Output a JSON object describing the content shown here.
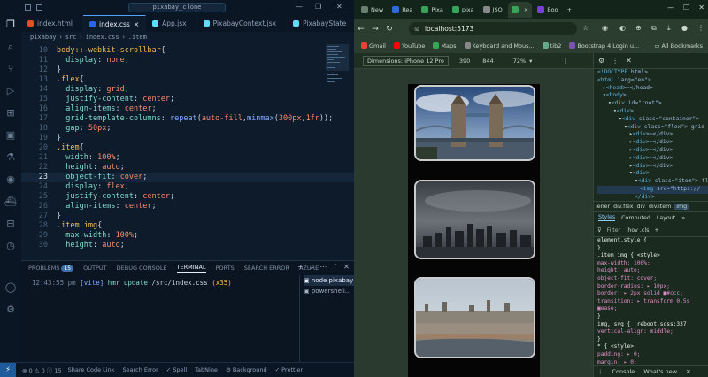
{
  "vscode": {
    "search": "pixabay_clone",
    "tabs": [
      {
        "label": "index.html",
        "color": "#e44d26"
      },
      {
        "label": "index.css",
        "color": "#2965f1",
        "active": true
      },
      {
        "label": "App.jsx",
        "color": "#61dafb"
      },
      {
        "label": "PixabayContext.jsx",
        "color": "#61dafb"
      },
      {
        "label": "PixabayState",
        "color": "#61dafb"
      }
    ],
    "breadcrumb": [
      "pixabay",
      "›",
      "src",
      "›",
      "index.css",
      "›",
      ".item"
    ],
    "lines": [
      {
        "n": "10",
        "code": [
          [
            "sel",
            "body::-webkit-scrollbar"
          ],
          [
            "pun",
            "{"
          ]
        ]
      },
      {
        "n": "11",
        "code": [
          [
            "pun",
            "  "
          ],
          [
            "prop",
            "display"
          ],
          [
            "pun",
            ": "
          ],
          [
            "val",
            "none"
          ],
          [
            "pun",
            ";"
          ]
        ]
      },
      {
        "n": "12",
        "code": [
          [
            "pun",
            "}"
          ]
        ]
      },
      {
        "n": "13",
        "code": [
          [
            "sel",
            ".flex"
          ],
          [
            "pun",
            "{"
          ]
        ]
      },
      {
        "n": "14",
        "code": [
          [
            "pun",
            "  "
          ],
          [
            "prop",
            "display"
          ],
          [
            "pun",
            ": "
          ],
          [
            "val",
            "grid"
          ],
          [
            "pun",
            ";"
          ]
        ]
      },
      {
        "n": "15",
        "code": [
          [
            "pun",
            "  "
          ],
          [
            "prop",
            "justify-content"
          ],
          [
            "pun",
            ": "
          ],
          [
            "val",
            "center"
          ],
          [
            "pun",
            ";"
          ]
        ]
      },
      {
        "n": "16",
        "code": [
          [
            "pun",
            "  "
          ],
          [
            "prop",
            "align-items"
          ],
          [
            "pun",
            ": "
          ],
          [
            "val",
            "center"
          ],
          [
            "pun",
            ";"
          ]
        ]
      },
      {
        "n": "17",
        "code": [
          [
            "pun",
            "  "
          ],
          [
            "prop",
            "grid-template-columns"
          ],
          [
            "pun",
            ": "
          ],
          [
            "fn",
            "repeat"
          ],
          [
            "pun",
            "("
          ],
          [
            "val",
            "auto-fill"
          ],
          [
            "pun",
            ","
          ],
          [
            "fn",
            "minmax"
          ],
          [
            "pun",
            "("
          ],
          [
            "num",
            "300px"
          ],
          [
            "pun",
            ","
          ],
          [
            "num",
            "1fr"
          ],
          [
            "pun",
            "));"
          ]
        ]
      },
      {
        "n": "18",
        "code": [
          [
            "pun",
            "  "
          ],
          [
            "prop",
            "gap"
          ],
          [
            "pun",
            ": "
          ],
          [
            "num",
            "50px"
          ],
          [
            "pun",
            ";"
          ]
        ]
      },
      {
        "n": "19",
        "code": [
          [
            "pun",
            "}"
          ]
        ]
      },
      {
        "n": "20",
        "code": [
          [
            "sel",
            ".item"
          ],
          [
            "pun",
            "{"
          ]
        ]
      },
      {
        "n": "21",
        "code": [
          [
            "pun",
            "  "
          ],
          [
            "prop",
            "width"
          ],
          [
            "pun",
            ": "
          ],
          [
            "num",
            "100%"
          ],
          [
            "pun",
            ";"
          ]
        ]
      },
      {
        "n": "22",
        "code": [
          [
            "pun",
            "  "
          ],
          [
            "prop",
            "height"
          ],
          [
            "pun",
            ": "
          ],
          [
            "val",
            "auto"
          ],
          [
            "pun",
            ";"
          ]
        ]
      },
      {
        "n": "23",
        "code": [
          [
            "pun",
            "  "
          ],
          [
            "prop",
            "object-fit"
          ],
          [
            "pun",
            ": "
          ],
          [
            "val",
            "cover"
          ],
          [
            "pun",
            ";"
          ]
        ]
      },
      {
        "n": "24",
        "code": [
          [
            "pun",
            "  "
          ],
          [
            "prop",
            "display"
          ],
          [
            "pun",
            ": "
          ],
          [
            "val",
            "flex"
          ],
          [
            "pun",
            ";"
          ]
        ]
      },
      {
        "n": "25",
        "code": [
          [
            "pun",
            "  "
          ],
          [
            "prop",
            "justify-content"
          ],
          [
            "pun",
            ": "
          ],
          [
            "val",
            "center"
          ],
          [
            "pun",
            ";"
          ]
        ]
      },
      {
        "n": "26",
        "code": [
          [
            "pun",
            "  "
          ],
          [
            "prop",
            "align-items"
          ],
          [
            "pun",
            ": "
          ],
          [
            "val",
            "center"
          ],
          [
            "pun",
            ";"
          ]
        ]
      },
      {
        "n": "27",
        "code": [
          [
            "pun",
            "}"
          ]
        ]
      },
      {
        "n": "28",
        "code": [
          [
            "sel",
            ".item img"
          ],
          [
            "pun",
            "{"
          ]
        ]
      },
      {
        "n": "29",
        "code": [
          [
            "pun",
            "  "
          ],
          [
            "prop",
            "max-width"
          ],
          [
            "pun",
            ": "
          ],
          [
            "num",
            "100%"
          ],
          [
            "pun",
            ";"
          ]
        ]
      },
      {
        "n": "30",
        "code": [
          [
            "pun",
            "  "
          ],
          [
            "prop",
            "height"
          ],
          [
            "pun",
            ": "
          ],
          [
            "val",
            "auto"
          ],
          [
            "pun",
            ";"
          ]
        ]
      }
    ],
    "current_line": "23",
    "panel": {
      "tabs": [
        "PROBLEMS",
        "OUTPUT",
        "DEBUG CONSOLE",
        "TERMINAL",
        "PORTS",
        "SEARCH ERROR",
        "AZURE"
      ],
      "active_tab": "TERMINAL",
      "problems_count": "15",
      "terminal_time": "12:43:55 pm",
      "terminal_tag": "[vite]",
      "terminal_msg": "hmr update",
      "terminal_path": "/src/index.css",
      "terminal_count": "(x35)",
      "terminals": [
        "node pixabay",
        "powershell..."
      ]
    },
    "status": {
      "remote": "⚡",
      "errors": "⊗ 0 ⚠ 0 ⓘ 15",
      "items": [
        "Share Code Link",
        "Search Error",
        "✓ Spell",
        "TabNine",
        "⚙ Background",
        "✓ Prettier"
      ]
    }
  },
  "browser": {
    "tabs": [
      {
        "label": "New",
        "color": "#6a7f70"
      },
      {
        "label": "Rea",
        "color": "#2d6cdf"
      },
      {
        "label": "Pixa",
        "color": "#3aa35a"
      },
      {
        "label": "pixa",
        "color": "#3aa35a"
      },
      {
        "label": "JSO",
        "color": "#888"
      },
      {
        "label": "",
        "color": "#3aa35a",
        "active": true
      },
      {
        "label": "Boo",
        "color": "#7a3fd6"
      }
    ],
    "url": "localhost:5173",
    "bookmarks": [
      "Gmail",
      "YouTube",
      "Maps",
      "Keyboard and Mous...",
      "tib2",
      "Bootstrap 4 Login u..."
    ],
    "all_bookmarks": "All Bookmarks",
    "device": {
      "label": "Dimensions: iPhone 12 Pro",
      "width": "390",
      "height": "844",
      "zoom": "72%"
    },
    "devtools": {
      "dom": [
        {
          "t": "<!DOCTYPE html>"
        },
        {
          "t": "<html lang=\"en\">"
        },
        {
          "t": "▸<head>⋯</head>"
        },
        {
          "t": "▾<body>"
        },
        {
          "t": "▾<div id=\"root\">"
        },
        {
          "t": "▾<div>"
        },
        {
          "t": "▾<div class=\"container\">"
        },
        {
          "t": "▾<div class=\"flex\"> grid"
        },
        {
          "t": "▸<div>⋯</div>"
        },
        {
          "t": "▸<div>⋯</div>"
        },
        {
          "t": "▸<div>⋯</div>"
        },
        {
          "t": "▸<div>⋯</div>"
        },
        {
          "t": "▸<div>⋯</div>"
        },
        {
          "t": "▾<div>"
        },
        {
          "t": "▾<div class=\"item\"> fl"
        },
        {
          "t": "<img src=\"https://"
        },
        {
          "t": "</div>"
        }
      ],
      "crumbs": [
        "iener",
        "div.flex",
        "div",
        "div.item",
        "img"
      ],
      "tabs": [
        "Styles",
        "Computed",
        "Layout",
        "»"
      ],
      "filter": "Filter",
      "filter_opts": ":hov .cls",
      "styles": [
        {
          "c": "ss",
          "t": "element.style {"
        },
        {
          "c": "ss",
          "t": "}"
        },
        {
          "c": "ss",
          "t": ".item img {            <style>"
        },
        {
          "c": "sp",
          "t": "  max-width: 100%;"
        },
        {
          "c": "sp",
          "t": "  height: auto;"
        },
        {
          "c": "sp",
          "t": "  object-fit: cover;"
        },
        {
          "c": "sp",
          "t": "  border-radius: ▸ 10px;"
        },
        {
          "c": "sp",
          "t": "  border: ▸ 2px solid ■#ccc;"
        },
        {
          "c": "sp",
          "t": "  transition: ▸ transform 0.5s"
        },
        {
          "c": "sp",
          "t": "      ▣ease;"
        },
        {
          "c": "ss",
          "t": "}"
        },
        {
          "c": "ss",
          "t": "img, svg {    _reboot.scss:337"
        },
        {
          "c": "sp",
          "t": "  vertical-align: middle;"
        },
        {
          "c": "ss",
          "t": "}"
        },
        {
          "c": "ss",
          "t": "* {                     <style>"
        },
        {
          "c": "sp",
          "t": "  padding: ▸ 0;"
        },
        {
          "c": "sp",
          "t": "  margin: ▸ 0;"
        }
      ],
      "console_tabs": [
        "Console",
        "What's new"
      ]
    }
  }
}
